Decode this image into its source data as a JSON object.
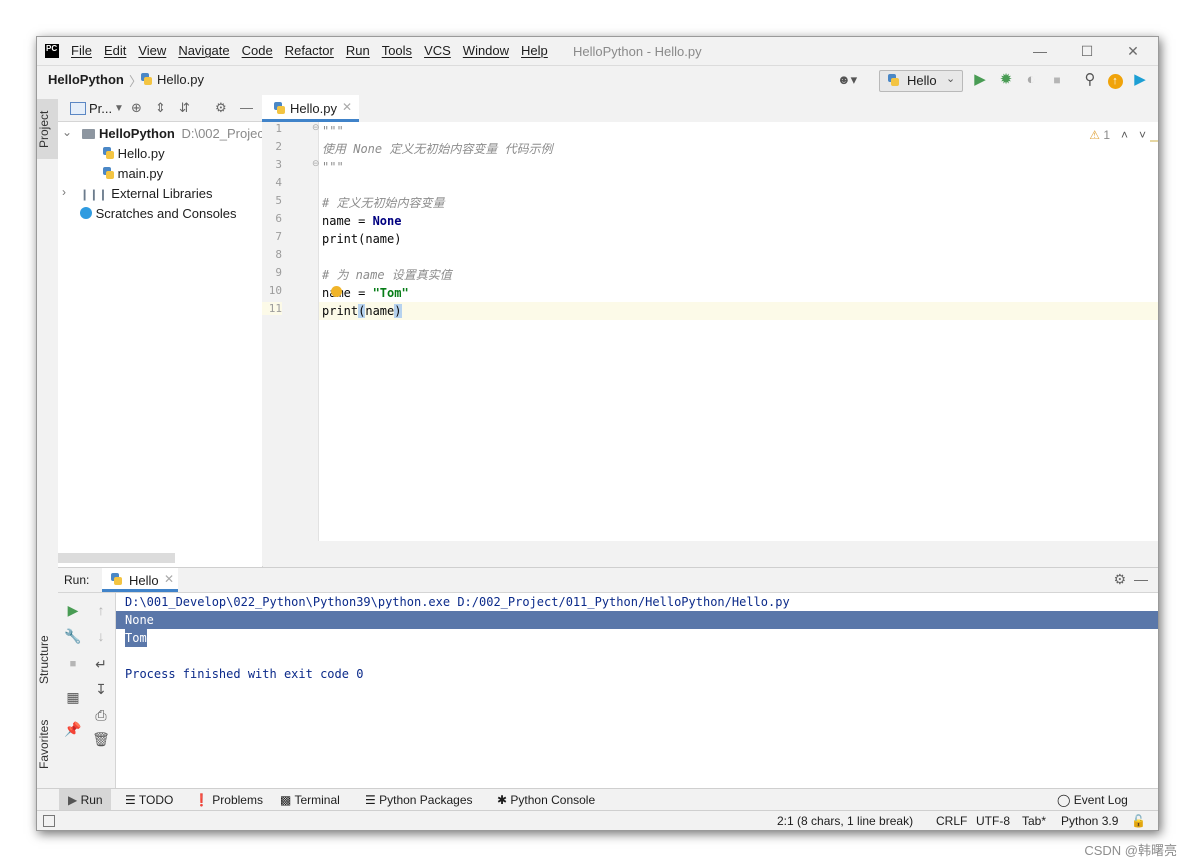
{
  "window": {
    "title": "HelloPython - Hello.py",
    "menu": [
      "File",
      "Edit",
      "View",
      "Navigate",
      "Code",
      "Refactor",
      "Run",
      "Tools",
      "VCS",
      "Window",
      "Help"
    ],
    "minimize": "—",
    "maximize": "☐",
    "close": "✕"
  },
  "navbar": {
    "project": "HelloPython",
    "file": "Hello.py",
    "run_config": "Hello"
  },
  "left_strip": {
    "project_tab": "Project",
    "structure_tab": "Structure",
    "favorites_tab": "Favorites"
  },
  "project_panel": {
    "title": "Pr...",
    "tree": [
      {
        "label": "HelloPython",
        "path": "D:\\002_Projec",
        "type": "project-root"
      },
      {
        "label": "Hello.py",
        "type": "py-file"
      },
      {
        "label": "main.py",
        "type": "py-file"
      },
      {
        "label": "External Libraries",
        "type": "libraries"
      },
      {
        "label": "Scratches and Consoles",
        "type": "scratches"
      }
    ]
  },
  "editor": {
    "tab_label": "Hello.py",
    "warning_count": "1",
    "current_line": 11,
    "lines": [
      {
        "n": "1",
        "text": "\"\"\""
      },
      {
        "n": "2",
        "text": "使用 None 定义无初始内容变量 代码示例"
      },
      {
        "n": "3",
        "text": "\"\"\""
      },
      {
        "n": "4",
        "text": ""
      },
      {
        "n": "5",
        "text": "# 定义无初始内容变量"
      },
      {
        "n": "6",
        "text": "name = None"
      },
      {
        "n": "7",
        "text": "print(name)"
      },
      {
        "n": "8",
        "text": ""
      },
      {
        "n": "9",
        "text": "# 为 name 设置真实值"
      },
      {
        "n": "10",
        "text": "name = \"Tom\""
      },
      {
        "n": "11",
        "text": "print(name)"
      }
    ]
  },
  "run_panel": {
    "label": "Run:",
    "tab_label": "Hello",
    "console": {
      "command": "D:\\001_Develop\\022_Python\\Python39\\python.exe D:/002_Project/011_Python/HelloPython/Hello.py",
      "output": [
        "None",
        "Tom"
      ],
      "exit": "Process finished with exit code 0"
    }
  },
  "bottom_tools": [
    "Run",
    "TODO",
    "Problems",
    "Terminal",
    "Python Packages",
    "Python Console"
  ],
  "event_log": "Event Log",
  "status": {
    "position": "2:1 (8 chars, 1 line break)",
    "line_sep": "CRLF",
    "encoding": "UTF-8",
    "indent": "Tab*",
    "interpreter": "Python 3.9"
  },
  "watermark": "CSDN @韩曙亮",
  "colors": {
    "accent": "#4083c9",
    "console_selection": "#5a77a9",
    "keyword": "#000080",
    "string": "#067d17",
    "run_green": "#499c54"
  }
}
